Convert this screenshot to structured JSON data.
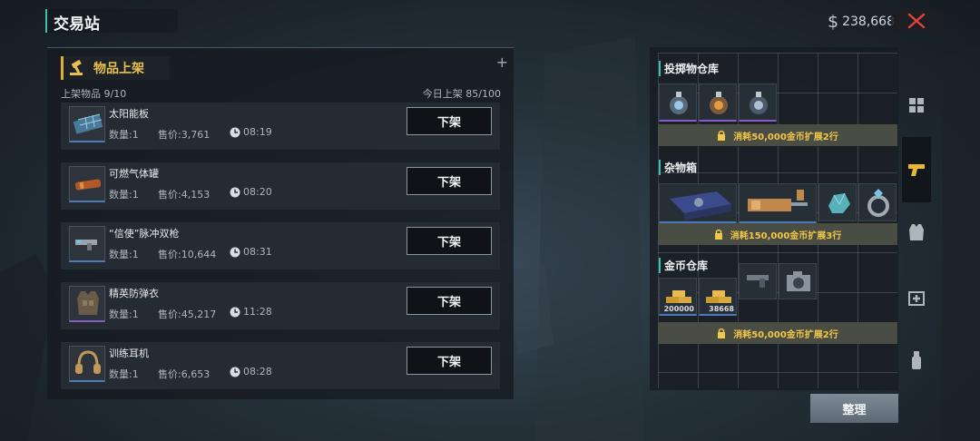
{
  "header": {
    "title": "交易站",
    "currency_symbol": "$",
    "money": "238,668"
  },
  "listing": {
    "section_title": "物品上架",
    "listed_label": "上架物品 9/10",
    "today_label": "今日上架 85/100",
    "unlist_label": "下架",
    "items": [
      {
        "name": "太阳能板",
        "qty": "数量:1",
        "price": "售价:3,761",
        "time": "08:19",
        "icon": "solar-panel-icon",
        "rarity": "blue"
      },
      {
        "name": "可燃气体罐",
        "qty": "数量:1",
        "price": "售价:4,153",
        "time": "08:20",
        "icon": "gas-canister-icon",
        "rarity": "blue"
      },
      {
        "name": "“信使”脉冲双枪",
        "qty": "数量:1",
        "price": "售价:10,644",
        "time": "08:31",
        "icon": "pulse-pistol-icon",
        "rarity": "blue"
      },
      {
        "name": "精英防弹衣",
        "qty": "数量:1",
        "price": "售价:45,217",
        "time": "11:28",
        "icon": "body-armor-icon",
        "rarity": "purple"
      },
      {
        "name": "训练耳机",
        "qty": "数量:1",
        "price": "售价:6,653",
        "time": "08:28",
        "icon": "headset-icon",
        "rarity": "blue"
      }
    ]
  },
  "warehouse": {
    "throwables_title": "投掷物仓库",
    "misc_title": "杂物箱",
    "gold_title": "金币仓库",
    "expand_throwables": "消耗50,000金币扩展2行",
    "expand_misc": "消耗150,000金币扩展3行",
    "expand_gold": "消耗50,000金币扩展2行",
    "gold_counts": [
      "200000",
      "38668"
    ],
    "sort_label": "整理"
  },
  "side_tabs": [
    "grid-icon",
    "pistol-icon",
    "vest-icon",
    "medkit-icon",
    "grenade-icon"
  ],
  "colors": {
    "accent_gold": "#e8c050",
    "accent_teal": "#3cc0b0",
    "rarity_purple": "#8a5cc8",
    "rarity_blue": "#4a7ab8",
    "close_red": "#e0443c"
  }
}
